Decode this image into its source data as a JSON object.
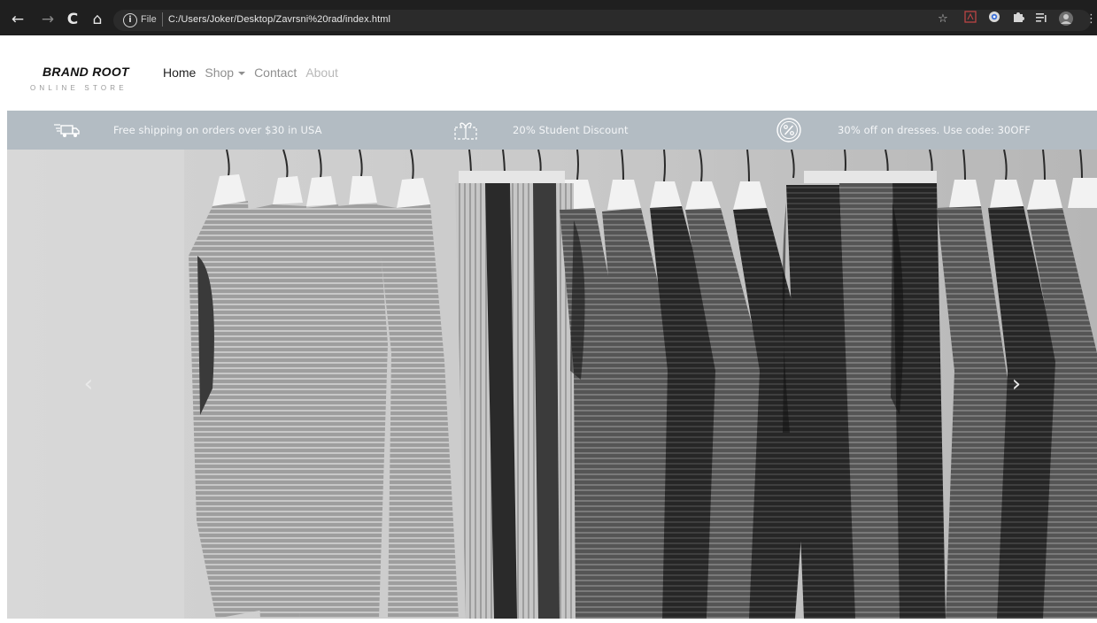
{
  "browser": {
    "back_glyph": "←",
    "forward_glyph": "→",
    "reload_glyph": "C",
    "home_glyph": "⌂",
    "scheme_label": "File",
    "url": "C:/Users/Joker/Desktop/Zavrsni%20rad/index.html",
    "icons": [
      "star-icon",
      "pdf-extension-icon",
      "block-extension-icon",
      "puzzle-icon",
      "reading-list-icon",
      "profile-avatar-icon",
      "menu-icon"
    ]
  },
  "site": {
    "brand_name": "BRAND ROOT",
    "brand_tagline": "ONLINE STORE",
    "nav": {
      "home": "Home",
      "shop": "Shop",
      "contact": "Contact",
      "about": "About"
    },
    "promos": [
      {
        "icon": "delivery-truck-icon",
        "text": "Free shipping on orders over $30 in USA"
      },
      {
        "icon": "gift-box-icon",
        "text": "20% Student Discount"
      },
      {
        "icon": "percent-badge-icon",
        "text": "30% off on dresses. Use code: 30OFF"
      }
    ],
    "carousel": {
      "prev_glyph": "‹",
      "next_glyph": "›"
    }
  },
  "colors": {
    "chrome_bg": "#1f1f1f",
    "promo_bar": "#b3bcc3",
    "brand_text": "#111111",
    "nav_active": "#222222"
  }
}
